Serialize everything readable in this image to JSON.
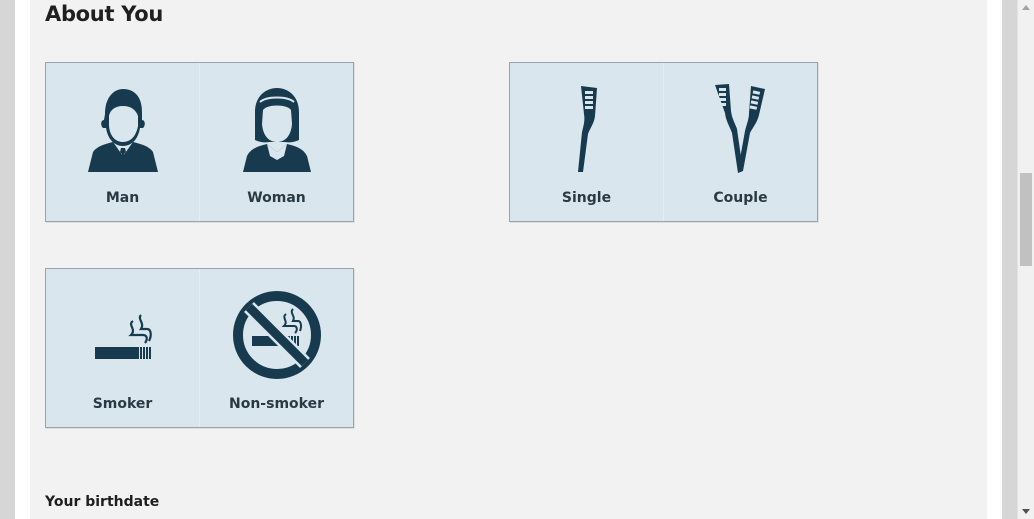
{
  "section": {
    "title": "About You"
  },
  "gender": {
    "options": [
      {
        "label": "Man",
        "icon": "man-icon"
      },
      {
        "label": "Woman",
        "icon": "woman-icon"
      }
    ]
  },
  "household": {
    "options": [
      {
        "label": "Single",
        "icon": "single-toothbrush-icon"
      },
      {
        "label": "Couple",
        "icon": "two-toothbrushes-icon"
      }
    ]
  },
  "smoking": {
    "options": [
      {
        "label": "Smoker",
        "icon": "cigarette-icon"
      },
      {
        "label": "Non-smoker",
        "icon": "no-smoking-icon"
      }
    ]
  },
  "birthdate": {
    "label": "Your birthdate"
  },
  "colors": {
    "icon": "#183a4f",
    "tile": "#d9e6ee",
    "page": "#f2f2f2"
  }
}
